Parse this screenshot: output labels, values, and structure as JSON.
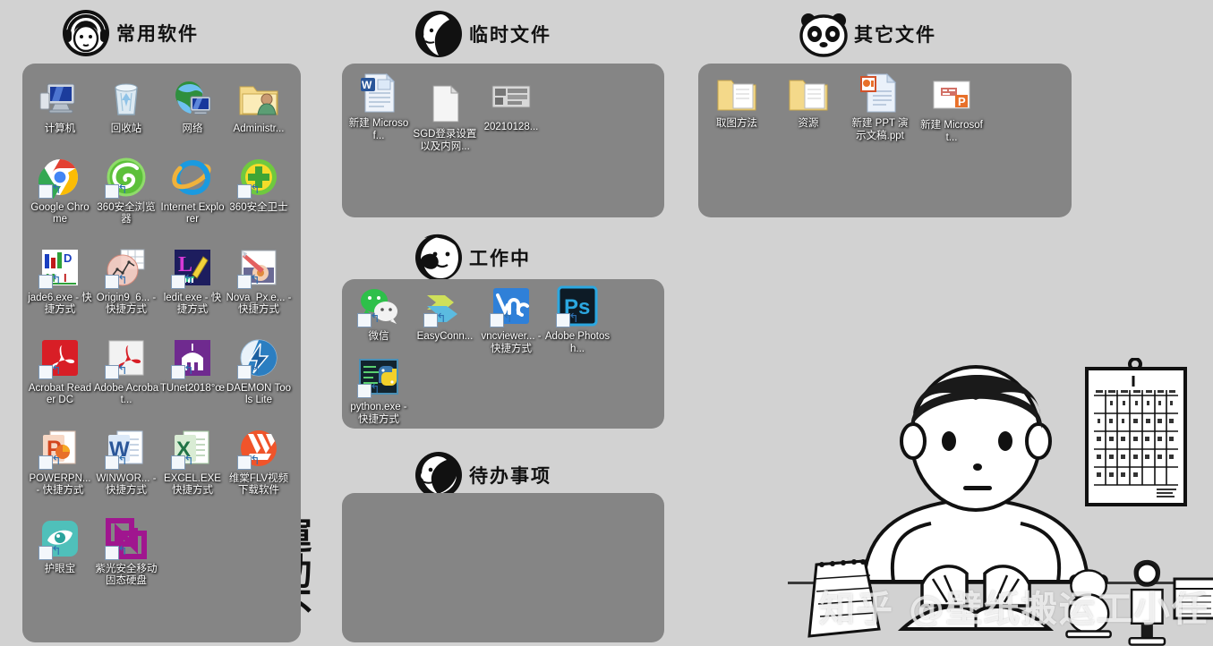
{
  "desktop": {
    "background_color": "#d2d2d2",
    "panel_color": "#858585",
    "watermark": "知乎 @壁纸搬运工小任",
    "decoration_text": "運動不足"
  },
  "groups": [
    {
      "id": "common-software",
      "title": "常用软件",
      "avatar": "face-headphones-icon",
      "items": [
        {
          "label": "计算机",
          "icon": "computer-icon",
          "shortcut": false
        },
        {
          "label": "回收站",
          "icon": "recycle-bin-icon",
          "shortcut": false
        },
        {
          "label": "网络",
          "icon": "network-icon",
          "shortcut": false
        },
        {
          "label": "Administr...",
          "icon": "user-folder-icon",
          "shortcut": false
        },
        {
          "label": "Google Chrome",
          "icon": "chrome-icon",
          "shortcut": true
        },
        {
          "label": "360安全浏览器",
          "icon": "360-browser-icon",
          "shortcut": true
        },
        {
          "label": "Internet Explorer",
          "icon": "internet-explorer-icon",
          "shortcut": false
        },
        {
          "label": "360安全卫士",
          "icon": "360-security-icon",
          "shortcut": true
        },
        {
          "label": "jade6.exe - 快捷方式",
          "icon": "jade6-icon",
          "shortcut": true
        },
        {
          "label": "Origin9_6... - 快捷方式",
          "icon": "origin9-icon",
          "shortcut": true
        },
        {
          "label": "ledit.exe - 快捷方式",
          "icon": "ledit-icon",
          "shortcut": true
        },
        {
          "label": "Nova_Px.e... - 快捷方式",
          "icon": "nova-px-icon",
          "shortcut": true
        },
        {
          "label": "Acrobat Reader DC",
          "icon": "acrobat-reader-icon",
          "shortcut": true
        },
        {
          "label": "Adobe Acrobat...",
          "icon": "adobe-acrobat-icon",
          "shortcut": true
        },
        {
          "label": "TUnet2018°œ",
          "icon": "tunet-icon",
          "shortcut": true
        },
        {
          "label": "DAEMON Tools Lite",
          "icon": "daemon-tools-icon",
          "shortcut": true
        },
        {
          "label": "POWERPN... - 快捷方式",
          "icon": "powerpoint-icon",
          "shortcut": true
        },
        {
          "label": "WINWOR... - 快捷方式",
          "icon": "word-icon",
          "shortcut": true
        },
        {
          "label": "EXCEL.EXE 快捷方式",
          "icon": "excel-icon",
          "shortcut": true
        },
        {
          "label": "维棠FLV视频下载软件",
          "icon": "weitang-flv-icon",
          "shortcut": true
        },
        {
          "label": "护眼宝",
          "icon": "eye-care-icon",
          "shortcut": true
        },
        {
          "label": "紫光安全移动固态硬盘",
          "icon": "unis-ssd-icon",
          "shortcut": true
        }
      ]
    },
    {
      "id": "temp-files",
      "title": "临时文件",
      "avatar": "face-profile-icon",
      "items": [
        {
          "label": "新建 Microsof...",
          "icon": "word-document-icon",
          "shortcut": false
        },
        {
          "label": "SGD登录设置以及内网...",
          "icon": "blank-document-icon",
          "shortcut": false
        },
        {
          "label": "20210128...",
          "icon": "image-thumbnail-icon",
          "shortcut": false
        }
      ]
    },
    {
      "id": "other-files",
      "title": "其它文件",
      "avatar": "panda-icon",
      "items": [
        {
          "label": "取图方法",
          "icon": "folder-icon",
          "shortcut": false
        },
        {
          "label": "资源",
          "icon": "folder-icon",
          "shortcut": false
        },
        {
          "label": "新建 PPT 演示文稿.ppt",
          "icon": "ppt-document-icon",
          "shortcut": false
        },
        {
          "label": "新建 Microsoft...",
          "icon": "ppt-thumbnail-icon",
          "shortcut": false
        }
      ]
    },
    {
      "id": "working",
      "title": "工作中",
      "avatar": "face-bob-icon",
      "items": [
        {
          "label": "微信",
          "icon": "wechat-icon",
          "shortcut": true
        },
        {
          "label": "EasyConn...",
          "icon": "easyconnect-icon",
          "shortcut": true
        },
        {
          "label": "vncviewer... - 快捷方式",
          "icon": "vnc-viewer-icon",
          "shortcut": true
        },
        {
          "label": "Adobe Photosh...",
          "icon": "photoshop-icon",
          "shortcut": true
        },
        {
          "label": "python.exe - 快捷方式",
          "icon": "python-icon",
          "shortcut": true
        }
      ]
    },
    {
      "id": "todo",
      "title": "待办事项",
      "avatar": "face-side-icon",
      "items": []
    }
  ]
}
